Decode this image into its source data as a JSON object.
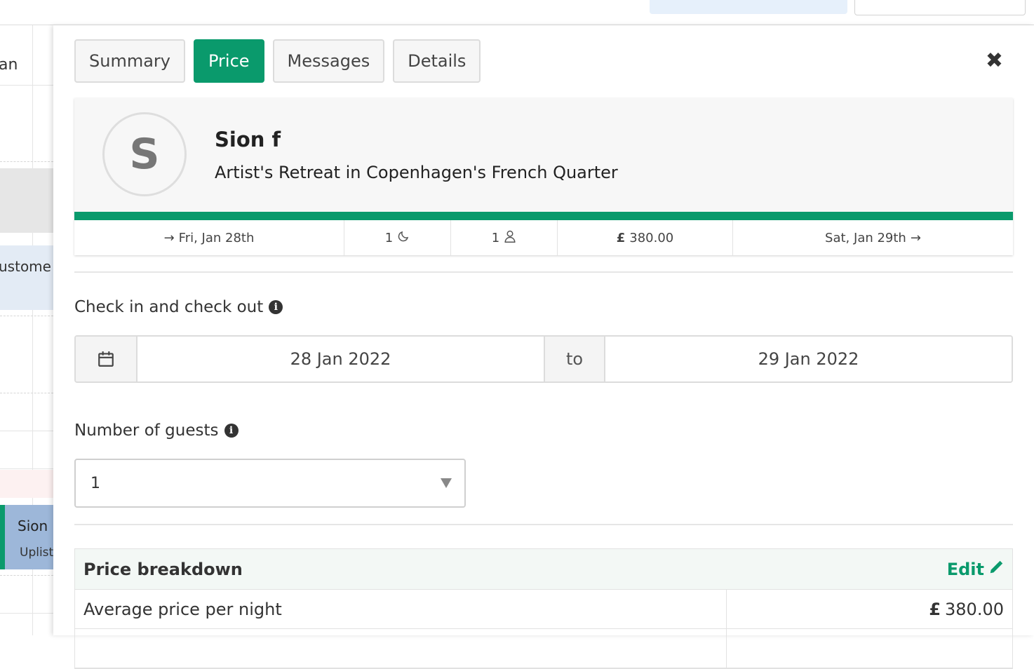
{
  "calendar": {
    "header_fragment": "an",
    "blue_block_text": "ustome",
    "booking_name": "Sion",
    "booking_sub": "Uplist"
  },
  "tabs": [
    {
      "label": "Summary",
      "active": false
    },
    {
      "label": "Price",
      "active": true
    },
    {
      "label": "Messages",
      "active": false
    },
    {
      "label": "Details",
      "active": false
    }
  ],
  "close_icon": "close-icon",
  "reservation": {
    "avatar_initial": "S",
    "guest_name": "Sion f",
    "listing_name": "Artist's Retreat in Copenhagen's French Quarter",
    "checkin": "Fri, Jan 28th",
    "nights": "1",
    "guests": "1",
    "price_currency": "£",
    "price": "380.00",
    "checkout": "Sat, Jan 29th",
    "progress_fraction": 1.0
  },
  "dates": {
    "label": "Check in and check out",
    "start": "28 Jan 2022",
    "separator": "to",
    "end": "29 Jan 2022"
  },
  "guests_field": {
    "label": "Number of guests",
    "value": "1"
  },
  "price_breakdown": {
    "title": "Price breakdown",
    "edit_label": "Edit",
    "rows": [
      {
        "label": "Average price per night",
        "currency": "£",
        "value": "380.00"
      }
    ]
  },
  "colors": {
    "accent": "#0a9a6c",
    "booking_block": "#9db7d9"
  }
}
